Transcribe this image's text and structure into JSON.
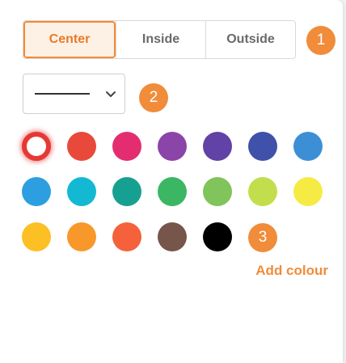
{
  "placement": {
    "options": [
      "Center",
      "Inside",
      "Outside"
    ],
    "selected": "Center"
  },
  "line_style": {
    "selected": "solid"
  },
  "steps": [
    "1",
    "2",
    "3"
  ],
  "colors": {
    "selected": "#ffffff",
    "swatches": [
      "#ffffff",
      "#e8493b",
      "#e42d70",
      "#8b44a8",
      "#6142a6",
      "#3f51a9",
      "#3d8fd5",
      "#2d9fe1",
      "#13b9d2",
      "#16a092",
      "#3bb663",
      "#80c45b",
      "#c2de4c",
      "#f6eb45",
      "#fcbf24",
      "#f8982a",
      "#f4613a",
      "#76554b",
      "#000000"
    ]
  },
  "add_colour_label": "Add colour"
}
